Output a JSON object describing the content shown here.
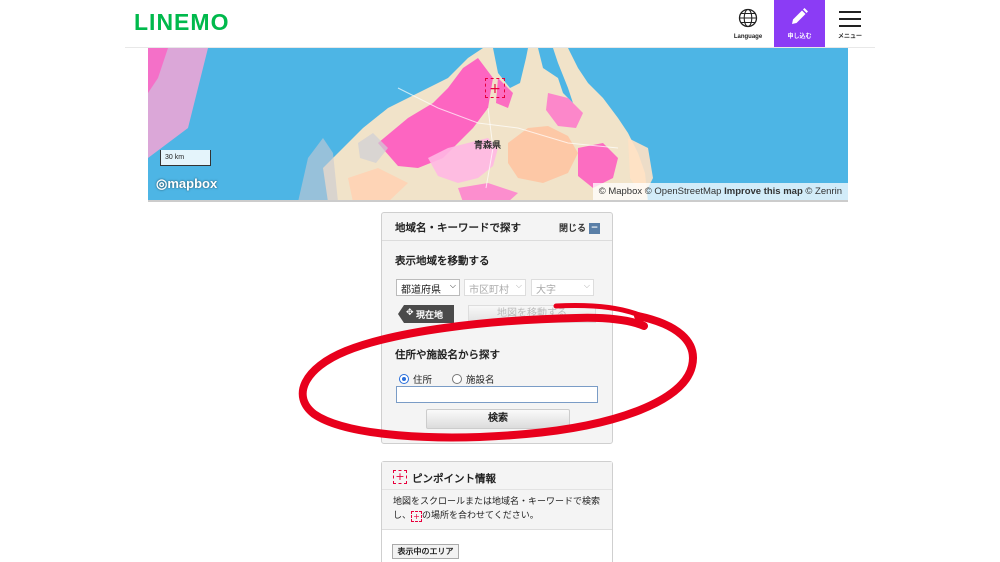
{
  "header": {
    "logo": "LINEM",
    "logo_o": "O",
    "language_label": "Language",
    "apply_label": "申し込む",
    "menu_label": "メニュー",
    "brand_color": "#00b94c",
    "apply_color": "#8b3cf5"
  },
  "map": {
    "scale_label": "30 km",
    "mapbox_logo": "mapbox",
    "attribution_1": "© Mapbox © OpenStreetMap",
    "attribution_improve": "Improve this map",
    "attribution_2": "© Zenrin",
    "prefecture_label": "青森県",
    "crosshair_symbol": "+",
    "water_color": "#4db5e5",
    "coverage_color": "#ff4fbf"
  },
  "search_panel": {
    "title": "地域名・キーワードで探す",
    "close_label": "閉じる",
    "close_symbol": "−",
    "move_section_title": "表示地域を移動する",
    "prefecture_select": "都道府県",
    "city_select": "市区町村",
    "district_select": "大字",
    "current_location_label": "現在地",
    "move_map_label": "地図を移動する",
    "address_section_title": "住所や施設名から探す",
    "radio_address": "住所",
    "radio_facility": "施設名",
    "search_value": "",
    "search_button": "検索"
  },
  "pinpoint_panel": {
    "icon_symbol": "+",
    "title": "ピンポイント情報",
    "desc_1": "地図をスクロールまたは地域名・キーワードで検索し、",
    "desc_2": "の場所を合わせてください。",
    "area_button": "表示中のエリア"
  },
  "annotation": {
    "color": "#e8001c"
  }
}
